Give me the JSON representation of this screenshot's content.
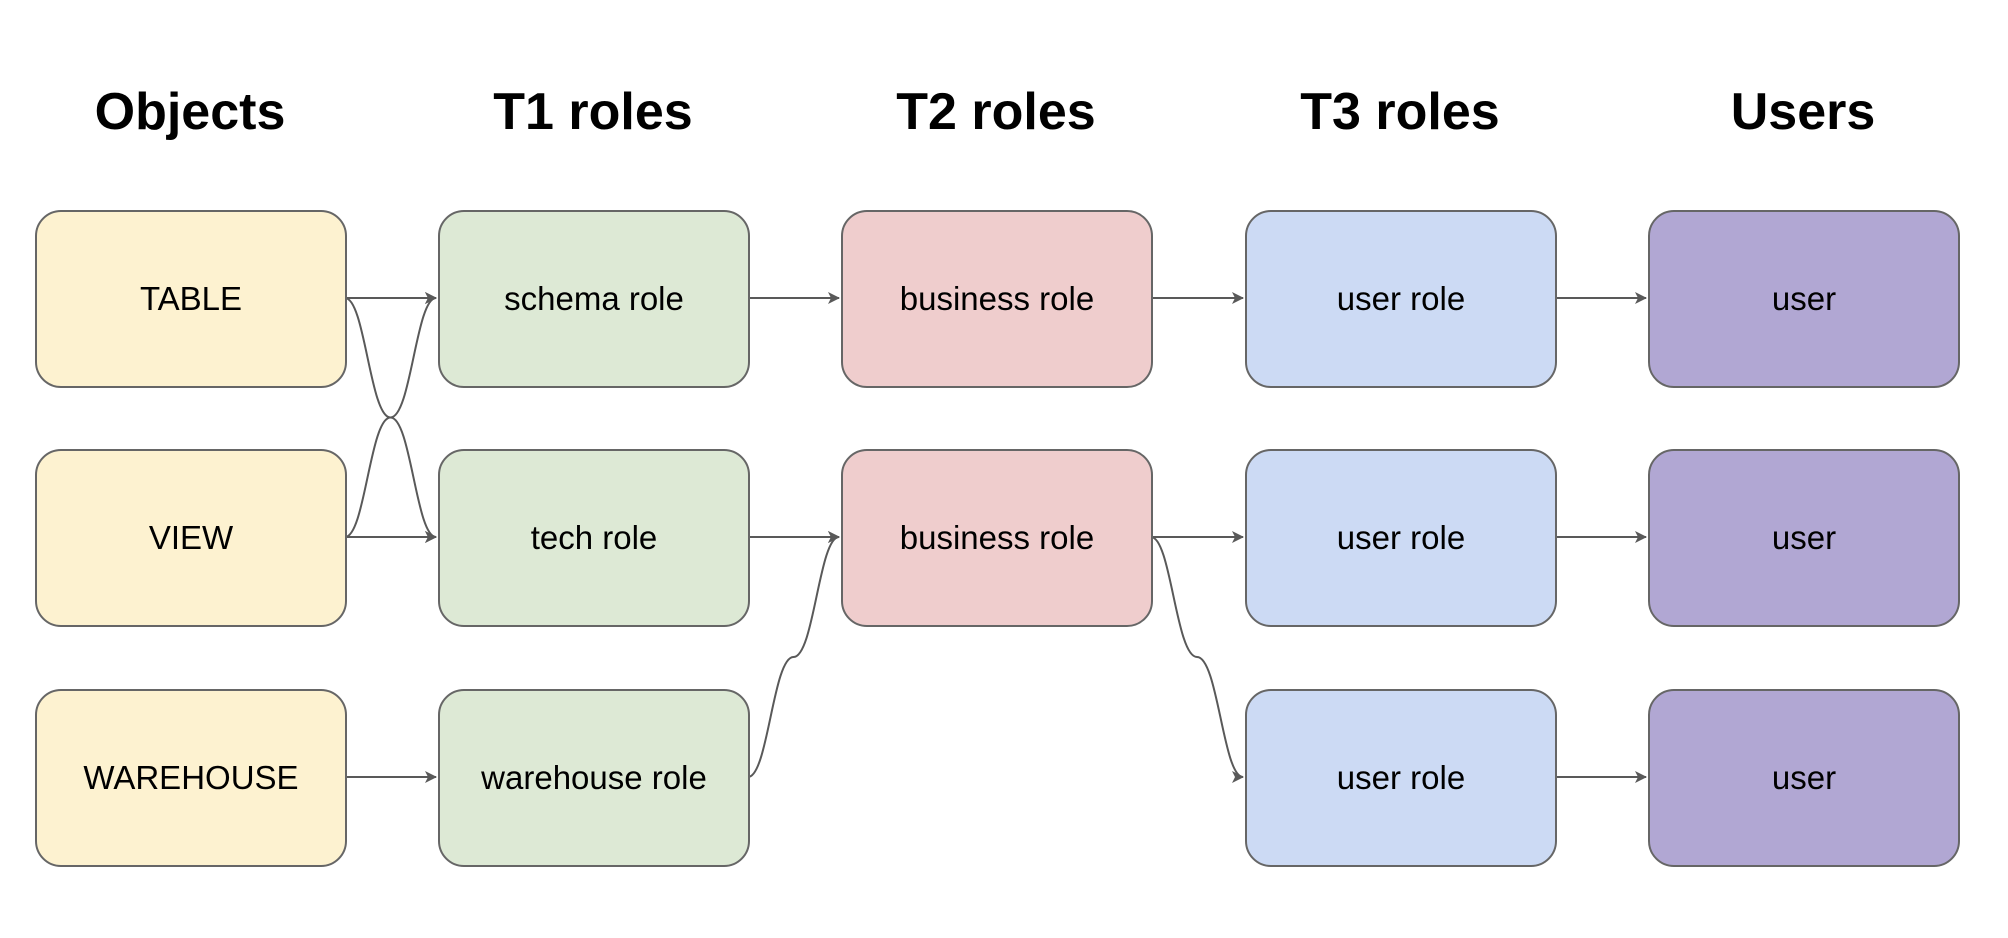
{
  "columns": [
    {
      "title": "Objects",
      "fill": "#fdf2d0"
    },
    {
      "title": "T1 roles",
      "fill": "#dde9d5"
    },
    {
      "title": "T2 roles",
      "fill": "#efcdcd"
    },
    {
      "title": "T3 roles",
      "fill": "#ccdaf4"
    },
    {
      "title": "Users",
      "fill": "#b1a7d3"
    }
  ],
  "nodes": {
    "table": {
      "label": "TABLE"
    },
    "view": {
      "label": "VIEW"
    },
    "warehouse": {
      "label": "WAREHOUSE"
    },
    "schema_role": {
      "label": "schema role"
    },
    "tech_role": {
      "label": "tech role"
    },
    "warehouse_role": {
      "label": "warehouse role"
    },
    "business_role_1": {
      "label": "business role"
    },
    "business_role_2": {
      "label": "business role"
    },
    "user_role_1": {
      "label": "user role"
    },
    "user_role_2": {
      "label": "user role"
    },
    "user_role_3": {
      "label": "user role"
    },
    "user_1": {
      "label": "user"
    },
    "user_2": {
      "label": "user"
    },
    "user_3": {
      "label": "user"
    }
  },
  "edges": [
    [
      "table",
      "schema_role"
    ],
    [
      "table",
      "tech_role"
    ],
    [
      "view",
      "schema_role"
    ],
    [
      "view",
      "tech_role"
    ],
    [
      "warehouse",
      "warehouse_role"
    ],
    [
      "schema_role",
      "business_role_1"
    ],
    [
      "tech_role",
      "business_role_2"
    ],
    [
      "warehouse_role",
      "business_role_2"
    ],
    [
      "business_role_1",
      "user_role_1"
    ],
    [
      "business_role_2",
      "user_role_2"
    ],
    [
      "business_role_2",
      "user_role_3"
    ],
    [
      "user_role_1",
      "user_1"
    ],
    [
      "user_role_2",
      "user_2"
    ],
    [
      "user_role_3",
      "user_3"
    ]
  ],
  "edge_color": "#595959",
  "border_color": "#666666"
}
